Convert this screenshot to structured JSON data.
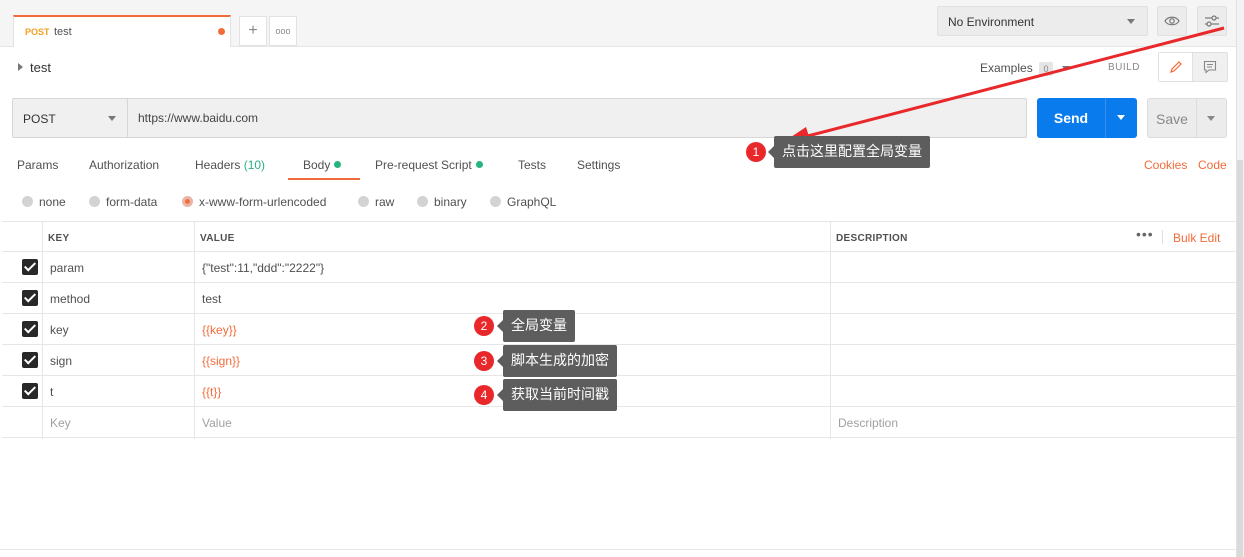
{
  "tabs": {
    "active": {
      "method": "POST",
      "name": "test"
    },
    "add_label": "+",
    "more_label": "ooo"
  },
  "environment": {
    "selected": "No Environment"
  },
  "request": {
    "title": "test",
    "examples_label": "Examples",
    "examples_count": "0",
    "build_label": "BUILD",
    "method": "POST",
    "url": "https://www.baidu.com",
    "send_label": "Send",
    "save_label": "Save"
  },
  "subtabs": {
    "params": "Params",
    "authorization": "Authorization",
    "headers": "Headers",
    "headers_count": "(10)",
    "body": "Body",
    "prerequest": "Pre-request Script",
    "tests": "Tests",
    "settings": "Settings",
    "cookies": "Cookies",
    "code": "Code"
  },
  "body_types": {
    "none": "none",
    "form_data": "form-data",
    "urlencoded": "x-www-form-urlencoded",
    "raw": "raw",
    "binary": "binary",
    "graphql": "GraphQL"
  },
  "table": {
    "headers": {
      "key": "KEY",
      "value": "VALUE",
      "description": "DESCRIPTION"
    },
    "dots_label": "•••",
    "bulk_edit": "Bulk Edit",
    "rows": [
      {
        "key": "param",
        "value": "{\"test\":11,\"ddd\":\"2222\"}"
      },
      {
        "key": "method",
        "value": "test"
      },
      {
        "key": "key",
        "value": "{{key}}"
      },
      {
        "key": "sign",
        "value": "{{sign}}"
      },
      {
        "key": "t",
        "value": "{{t}}"
      }
    ],
    "placeholder": {
      "key": "Key",
      "value": "Value",
      "description": "Description"
    }
  },
  "annotations": [
    {
      "number": "1",
      "text": "点击这里配置全局变量"
    },
    {
      "number": "2",
      "text": "全局变量"
    },
    {
      "number": "3",
      "text": "脚本生成的加密"
    },
    {
      "number": "4",
      "text": "获取当前时间戳"
    }
  ],
  "colors": {
    "accent": "#f26b3a",
    "send": "#097bed",
    "green": "#26b47f",
    "badge": "#e8282b",
    "note_bg": "#5d5d5d"
  }
}
